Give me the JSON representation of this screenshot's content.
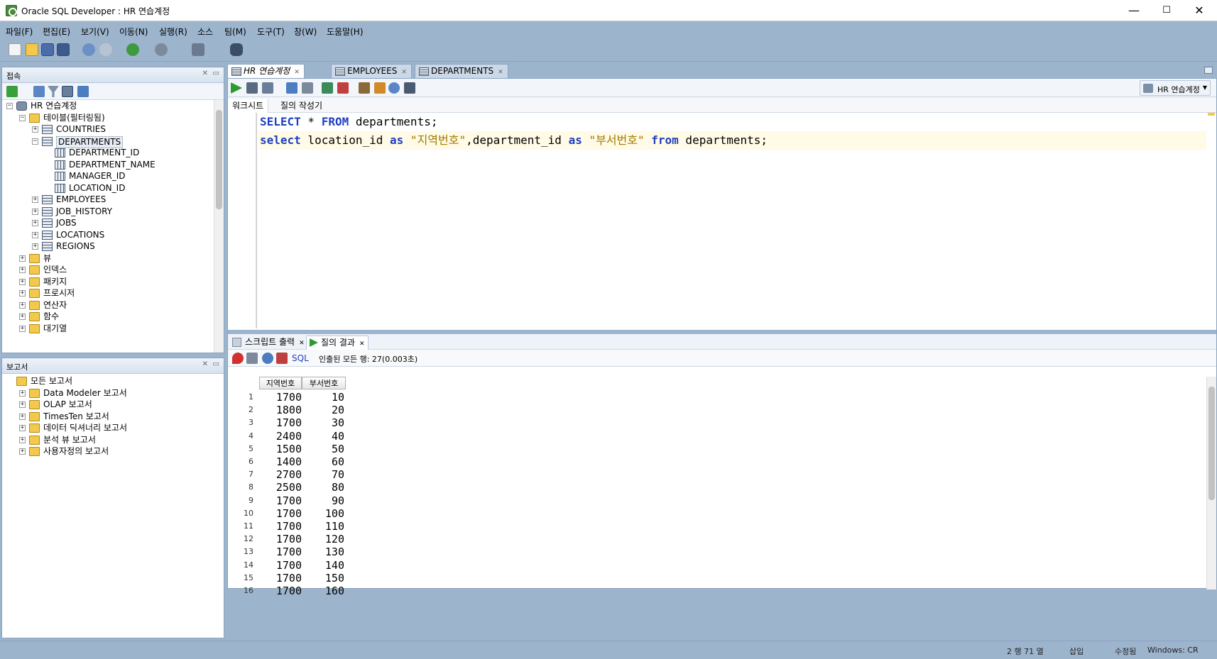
{
  "window": {
    "title": "Oracle SQL Developer : HR 연습계정",
    "minimize": "—",
    "maximize": "☐",
    "close": "✕"
  },
  "menu": [
    "파일(F)",
    "편집(E)",
    "보기(V)",
    "이동(N)",
    "실행(R)",
    "소스",
    "팀(M)",
    "도구(T)",
    "창(W)",
    "도움말(H)"
  ],
  "connections_panel": {
    "title": "접속",
    "tree": [
      {
        "label": "HR 연습계정",
        "level": 0,
        "icon": "db",
        "exp": "−"
      },
      {
        "label": "테이블(필터링됨)",
        "level": 1,
        "icon": "folder",
        "exp": "−"
      },
      {
        "label": "COUNTRIES",
        "level": 2,
        "icon": "table",
        "exp": "+"
      },
      {
        "label": "DEPARTMENTS",
        "level": 2,
        "icon": "table",
        "exp": "−",
        "selected": true
      },
      {
        "label": "DEPARTMENT_ID",
        "level": 3,
        "icon": "col"
      },
      {
        "label": "DEPARTMENT_NAME",
        "level": 3,
        "icon": "col"
      },
      {
        "label": "MANAGER_ID",
        "level": 3,
        "icon": "col"
      },
      {
        "label": "LOCATION_ID",
        "level": 3,
        "icon": "col"
      },
      {
        "label": "EMPLOYEES",
        "level": 2,
        "icon": "table",
        "exp": "+"
      },
      {
        "label": "JOB_HISTORY",
        "level": 2,
        "icon": "table",
        "exp": "+"
      },
      {
        "label": "JOBS",
        "level": 2,
        "icon": "table",
        "exp": "+"
      },
      {
        "label": "LOCATIONS",
        "level": 2,
        "icon": "table",
        "exp": "+"
      },
      {
        "label": "REGIONS",
        "level": 2,
        "icon": "table",
        "exp": "+"
      },
      {
        "label": "뷰",
        "level": 1,
        "icon": "folder",
        "exp": "+"
      },
      {
        "label": "인덱스",
        "level": 1,
        "icon": "folder",
        "exp": "+"
      },
      {
        "label": "패키지",
        "level": 1,
        "icon": "folder",
        "exp": "+"
      },
      {
        "label": "프로시저",
        "level": 1,
        "icon": "folder",
        "exp": "+"
      },
      {
        "label": "연산자",
        "level": 1,
        "icon": "folder",
        "exp": "+"
      },
      {
        "label": "함수",
        "level": 1,
        "icon": "folder",
        "exp": "+"
      },
      {
        "label": "대기열",
        "level": 1,
        "icon": "folder",
        "exp": "+"
      }
    ]
  },
  "reports_panel": {
    "title": "보고서",
    "tree": [
      {
        "label": "모든 보고서",
        "level": 0,
        "icon": "folder"
      },
      {
        "label": "Data Modeler 보고서",
        "level": 1,
        "icon": "folder",
        "exp": "+"
      },
      {
        "label": "OLAP 보고서",
        "level": 1,
        "icon": "folder",
        "exp": "+"
      },
      {
        "label": "TimesTen 보고서",
        "level": 1,
        "icon": "folder",
        "exp": "+"
      },
      {
        "label": "데이터 딕셔너리 보고서",
        "level": 1,
        "icon": "folder",
        "exp": "+"
      },
      {
        "label": "분석 뷰 보고서",
        "level": 1,
        "icon": "folder",
        "exp": "+"
      },
      {
        "label": "사용자정의 보고서",
        "level": 1,
        "icon": "folder",
        "exp": "+"
      }
    ]
  },
  "doc_tabs": [
    {
      "label": "HR 연습계정",
      "active": true
    },
    {
      "label": "EMPLOYEES"
    },
    {
      "label": "DEPARTMENTS"
    }
  ],
  "connection_selector": "HR 연습계정",
  "editor_tabs": [
    "워크시트",
    "질의 작성기"
  ],
  "sql": {
    "line1": {
      "kw1": "SELECT",
      "mid": " * ",
      "kw2": "FROM",
      "rest": " departments;"
    },
    "line2": {
      "kw1": "select",
      "a": " location_id ",
      "kw2": "as",
      "s1": " \"지역번호\"",
      "b": ",department_id ",
      "kw3": "as",
      "s2": " \"부서번호\" ",
      "kw4": "from",
      "rest": " departments;"
    }
  },
  "result_tabs": [
    "스크립트 출력",
    "질의 결과"
  ],
  "result_toolbar": {
    "sql_label": "SQL",
    "fetched": "인출된 모든 행: 27(0.003초)"
  },
  "grid": {
    "columns": [
      "지역번호",
      "부서번호"
    ],
    "rows": [
      [
        "1",
        "1700",
        "10"
      ],
      [
        "2",
        "1800",
        "20"
      ],
      [
        "3",
        "1700",
        "30"
      ],
      [
        "4",
        "2400",
        "40"
      ],
      [
        "5",
        "1500",
        "50"
      ],
      [
        "6",
        "1400",
        "60"
      ],
      [
        "7",
        "2700",
        "70"
      ],
      [
        "8",
        "2500",
        "80"
      ],
      [
        "9",
        "1700",
        "90"
      ],
      [
        "10",
        "1700",
        "100"
      ],
      [
        "11",
        "1700",
        "110"
      ],
      [
        "12",
        "1700",
        "120"
      ],
      [
        "13",
        "1700",
        "130"
      ],
      [
        "14",
        "1700",
        "140"
      ],
      [
        "15",
        "1700",
        "150"
      ],
      [
        "16",
        "1700",
        "160"
      ]
    ]
  },
  "status": {
    "pos": "2 행 71 열",
    "mode": "삽입",
    "modified": "수정됨",
    "eol": "Windows: CR"
  },
  "colors": {
    "chrome": "#9db4cd",
    "keyword": "#1f3fbf",
    "string": "#a07a00"
  }
}
